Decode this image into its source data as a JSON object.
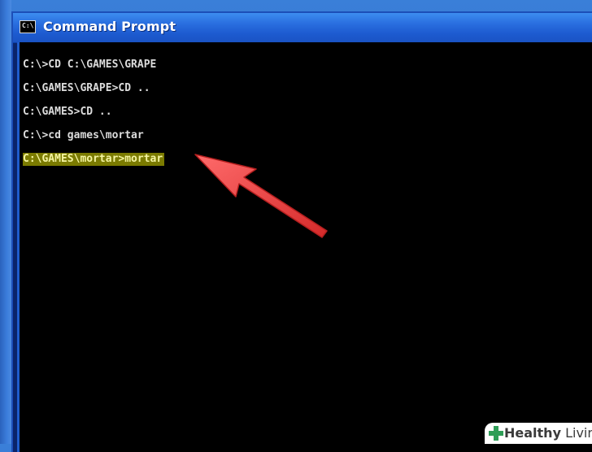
{
  "window": {
    "title": "Command Prompt",
    "icon": "cmd-icon",
    "icon_text": "C:\\"
  },
  "console": {
    "lines": [
      "C:\\>CD C:\\GAMES\\GRAPE",
      "C:\\GAMES\\GRAPE>CD ..",
      "C:\\GAMES>CD ..",
      "C:\\>cd games\\mortar",
      "C:\\GAMES\\mortar>mortar"
    ],
    "highlight_color": "#7b7b00"
  },
  "annotation": {
    "arrow_color": "#e8393a",
    "arrow": "red-arrow-icon"
  },
  "watermark": {
    "brand_bold": "Healthy",
    "brand_light": " Living",
    "icon": "green-cross-icon"
  }
}
